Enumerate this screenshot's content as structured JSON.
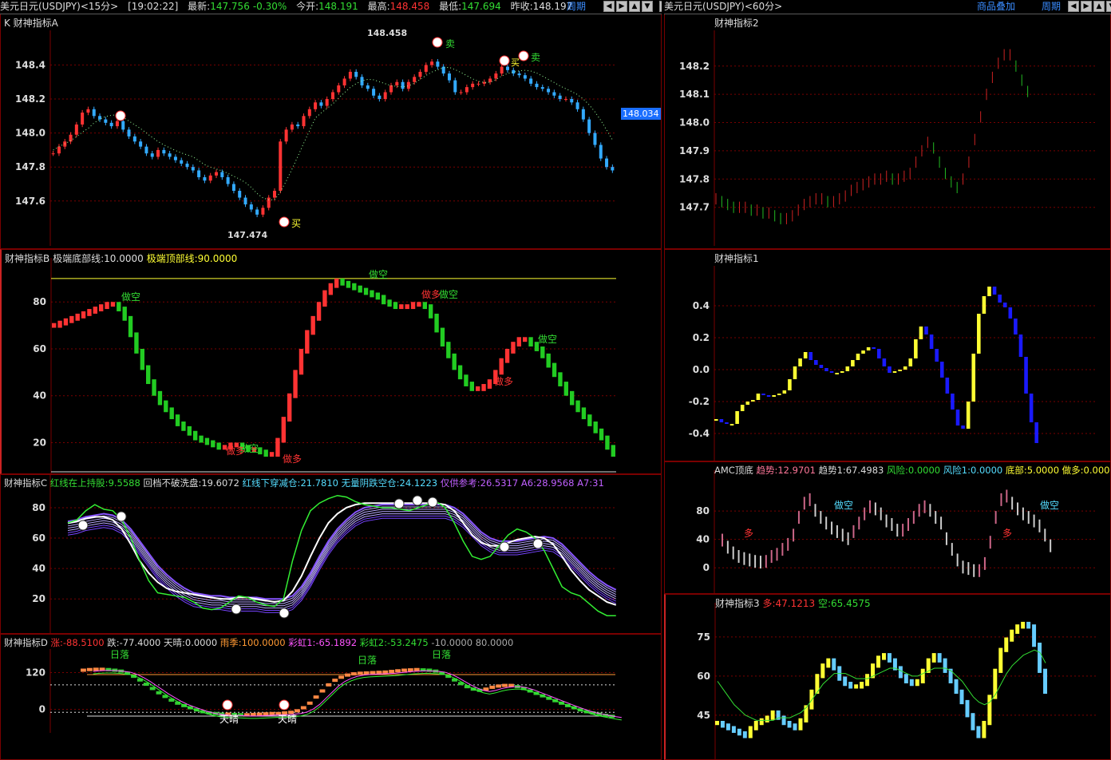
{
  "left_bar": {
    "symbol": "美元日元(USDJPY)<15分>",
    "time": "[19:02:22]",
    "latest_label": "最新:",
    "latest": "147.756",
    "change": "-0.30%",
    "open_label": "今开:",
    "open": "148.191",
    "high_label": "最高:",
    "high": "148.458",
    "low_label": "最低:",
    "low": "147.694",
    "prev_label": "昨收:",
    "prev": "148.197",
    "period_btn": "周期"
  },
  "right_bar": {
    "symbol": "美元日元(USDJPY)<60分>",
    "overlay_btn": "商品叠加",
    "period_btn": "周期"
  },
  "nav_glyphs": [
    "◀",
    "▶",
    "▲",
    "▼"
  ],
  "window_glyph": "□",
  "panes": {
    "A": {
      "title": "K  财神指标A",
      "hi_label": "148.458",
      "lo_label": "147.474",
      "price_tag": "148.034",
      "sell": "卖",
      "buy": "买"
    },
    "B": {
      "title": "财神指标B",
      "p1_label": "极端底部线:",
      "p1": "10.0000",
      "p2_label": "极端顶部线:",
      "p2": "90.0000",
      "short": "做空",
      "long": "做多"
    },
    "C": {
      "title": "财神指标C",
      "v1_label": "红线在上持股:",
      "v1": "9.5588",
      "v2_label": "回档不破洗盘:",
      "v2": "19.6072",
      "v3_label": "红线下穿减仓:",
      "v3": "21.7810",
      "v4_label": "无量阴跌空仓:",
      "v4": "24.1223",
      "v5_label": "仅供参考:",
      "v5": "26.5317",
      "v6_label": "A6:",
      "v6": "28.9568",
      "v7_label": "A7:31"
    },
    "D": {
      "title": "财神指标D",
      "v1_label": "涨:",
      "v1": "-88.5100",
      "v2_label": "跌:",
      "v2": "-77.4000",
      "v3_label": "天晴:",
      "v3": "0.0000",
      "v4_label": "雨季:",
      "v4": "100.0000",
      "v5_label": "彩虹1:",
      "v5": "-65.1892",
      "v6_label": "彩虹2:",
      "v6": "-53.2475",
      "v7": "-10.0000",
      "v8": "80.0000",
      "sunny": "天晴",
      "sun": "日落"
    },
    "R2": {
      "title": "财神指标2"
    },
    "R1": {
      "title": "财神指标1"
    },
    "AMC": {
      "title": "AMC顶底",
      "v1_label": "趋势:",
      "v1": "12.9701",
      "v2_label": "趋势1:",
      "v2": "67.4983",
      "v3_label": "风险:",
      "v3": "0.0000",
      "v4_label": "风险1:",
      "v4": "0.0000",
      "v5_label": "底部:",
      "v5": "5.0000",
      "v6_label": "做多:0.000",
      "short": "做空",
      "long": "多"
    },
    "R3": {
      "title": "财神指标3",
      "v1_label": "多:",
      "v1": "47.1213",
      "v2_label": "空:",
      "v2": "65.4575"
    }
  },
  "colors": {
    "up": "#ff3333",
    "down": "#33aaff",
    "grid": "#7a0000",
    "green": "#22cc22",
    "yellow": "#ffff33",
    "blue": "#1a1aff"
  },
  "chart_data": [
    {
      "id": "A",
      "type": "candlestick",
      "yticks": [
        147.6,
        147.8,
        148.0,
        148.2,
        148.4
      ],
      "ylim": [
        147.43,
        148.51
      ],
      "close": [
        147.88,
        147.92,
        147.95,
        147.99,
        148.05,
        148.12,
        148.14,
        148.1,
        148.08,
        148.06,
        148.04,
        148.07,
        148.02,
        147.98,
        147.95,
        147.92,
        147.88,
        147.86,
        147.9,
        147.88,
        147.86,
        147.84,
        147.82,
        147.8,
        147.78,
        147.74,
        147.72,
        147.75,
        147.77,
        147.74,
        147.7,
        147.66,
        147.62,
        147.58,
        147.55,
        147.52,
        147.56,
        147.62,
        147.66,
        147.95,
        148.02,
        148.05,
        148.04,
        148.1,
        148.14,
        148.18,
        148.16,
        148.2,
        148.24,
        148.28,
        148.32,
        148.36,
        148.33,
        148.28,
        148.26,
        148.22,
        148.2,
        148.24,
        148.28,
        148.3,
        148.26,
        148.3,
        148.33,
        148.36,
        148.4,
        148.42,
        148.39,
        148.35,
        148.31,
        148.24,
        148.24,
        148.27,
        148.29,
        148.29,
        148.3,
        148.32,
        148.35,
        148.39,
        148.37,
        148.35,
        148.34,
        148.32,
        148.29,
        148.27,
        148.26,
        148.24,
        148.22,
        148.2,
        148.2,
        148.18,
        148.14,
        148.08,
        148.0,
        147.93,
        147.85,
        147.8,
        147.78
      ]
    },
    {
      "id": "B",
      "type": "bar-indicator",
      "yticks": [
        20,
        40,
        60,
        80
      ],
      "ylim": [
        13,
        92
      ],
      "values": [
        70,
        71,
        72,
        73,
        74,
        75,
        76,
        77,
        78,
        79,
        79,
        77,
        73,
        66,
        59,
        52,
        46,
        41,
        37,
        34,
        31,
        28,
        26,
        24,
        22,
        21,
        20,
        19,
        18,
        18,
        19,
        19,
        18,
        17,
        17,
        16,
        15,
        15,
        21,
        30,
        40,
        50,
        59,
        67,
        73,
        79,
        84,
        87,
        89,
        88,
        87,
        86,
        85,
        84,
        83,
        82,
        80,
        79,
        78,
        78,
        78,
        79,
        79,
        78,
        74,
        68,
        62,
        57,
        52,
        48,
        45,
        43,
        43,
        44,
        46,
        50,
        55,
        59,
        62,
        64,
        64,
        62,
        60,
        57,
        53,
        49,
        45,
        41,
        37,
        34,
        31,
        28,
        25,
        22,
        18,
        15
      ],
      "ref_line": 90
    },
    {
      "id": "C",
      "type": "line-indicator",
      "yticks": [
        20,
        40,
        60,
        80
      ],
      "ylim": [
        7,
        91
      ],
      "green": [
        70,
        72,
        78,
        82,
        79,
        78,
        72,
        60,
        45,
        32,
        24,
        23,
        22,
        21,
        18,
        14,
        13,
        14,
        18,
        22,
        21,
        18,
        16,
        15,
        20,
        45,
        65,
        78,
        83,
        86,
        88,
        87,
        84,
        82,
        81,
        80,
        80,
        79,
        78,
        80,
        82,
        84,
        80,
        70,
        58,
        48,
        46,
        48,
        55,
        62,
        66,
        64,
        60,
        52,
        40,
        28,
        24,
        22,
        17,
        12,
        9,
        9
      ],
      "white": [
        70,
        71,
        73,
        74,
        74,
        72,
        66,
        56,
        45,
        37,
        31,
        27,
        25,
        24,
        23,
        22,
        21,
        20,
        20,
        21,
        21,
        20,
        19,
        18,
        19,
        25,
        35,
        48,
        60,
        70,
        76,
        80,
        82,
        83,
        83,
        83,
        83,
        83,
        83,
        83,
        83,
        83,
        82,
        78,
        70,
        62,
        57,
        55,
        55,
        57,
        59,
        60,
        61,
        60,
        56,
        48,
        39,
        32,
        26,
        22,
        18,
        16
      ],
      "purple": [
        71,
        72,
        74,
        75,
        76,
        75,
        72,
        66,
        58,
        50,
        42,
        36,
        31,
        27,
        24,
        23,
        22,
        22,
        21,
        21,
        21,
        21,
        20,
        20,
        20,
        22,
        28,
        37,
        48,
        58,
        66,
        72,
        77,
        80,
        81,
        82,
        82,
        82,
        82,
        82,
        82,
        82,
        82,
        80,
        76,
        70,
        64,
        60,
        58,
        58,
        58,
        59,
        60,
        61,
        60,
        56,
        50,
        44,
        38,
        33,
        29,
        26
      ]
    },
    {
      "id": "D",
      "type": "step-indicator",
      "yticks": [
        0,
        120
      ],
      "ylim": [
        -25,
        145
      ],
      "values": [
        128,
        130,
        131,
        131,
        130,
        128,
        125,
        118,
        108,
        96,
        82,
        68,
        54,
        42,
        30,
        20,
        12,
        5,
        -2,
        -8,
        -12,
        -14,
        -16,
        -16,
        -17,
        -18,
        -18,
        -17,
        -16,
        -15,
        -14,
        -14,
        -12,
        -10,
        -5,
        5,
        20,
        40,
        60,
        80,
        95,
        105,
        112,
        116,
        118,
        119,
        120,
        121,
        122,
        124,
        126,
        128,
        129,
        130,
        129,
        128,
        125,
        118,
        108,
        96,
        84,
        74,
        66,
        62,
        66,
        72,
        76,
        78,
        78,
        74,
        68,
        60,
        52,
        44,
        36,
        28,
        20,
        12,
        5,
        -2,
        -8,
        -12,
        -16,
        -20,
        -23
      ],
      "dotted_levels": [
        80,
        -10
      ]
    },
    {
      "id": "R2",
      "type": "stick",
      "yticks": [
        147.7,
        147.8,
        147.9,
        148.0,
        148.1,
        148.2
      ],
      "ylim": [
        147.62,
        148.27
      ],
      "values": [
        147.73,
        147.72,
        147.71,
        147.7,
        147.7,
        147.7,
        147.69,
        147.69,
        147.68,
        147.68,
        147.67,
        147.66,
        147.66,
        147.67,
        147.69,
        147.71,
        147.72,
        147.73,
        147.73,
        147.72,
        147.72,
        147.73,
        147.74,
        147.76,
        147.77,
        147.78,
        147.79,
        147.8,
        147.8,
        147.81,
        147.8,
        147.8,
        147.81,
        147.82,
        147.86,
        147.9,
        147.93,
        147.91,
        147.86,
        147.82,
        147.79,
        147.77,
        147.8,
        147.86,
        147.94,
        148.02,
        148.1,
        148.16,
        148.21,
        148.24,
        148.24,
        148.2,
        148.15,
        148.11
      ]
    },
    {
      "id": "R1",
      "type": "column",
      "yticks": [
        -0.4,
        -0.2,
        0,
        0.2,
        0.4
      ],
      "ylim": [
        -0.5,
        0.55
      ],
      "values": [
        -0.31,
        -0.33,
        -0.34,
        -0.34,
        -0.26,
        -0.22,
        -0.2,
        -0.19,
        -0.15,
        -0.16,
        -0.17,
        -0.16,
        -0.15,
        -0.13,
        -0.06,
        0.02,
        0.07,
        0.11,
        0.06,
        0.03,
        0.01,
        -0.01,
        -0.02,
        -0.02,
        -0.01,
        0.02,
        0.06,
        0.1,
        0.12,
        0.14,
        0.13,
        0.07,
        0.02,
        -0.02,
        -0.01,
        0.0,
        0.02,
        0.07,
        0.19,
        0.27,
        0.22,
        0.13,
        0.05,
        -0.05,
        -0.15,
        -0.25,
        -0.35,
        -0.37,
        -0.2,
        0.1,
        0.35,
        0.46,
        0.52,
        0.47,
        0.42,
        0.39,
        0.32,
        0.22,
        0.08,
        -0.15,
        -0.33,
        -0.46
      ]
    },
    {
      "id": "AMC",
      "type": "column",
      "yticks": [
        0,
        40,
        80
      ],
      "ylim": [
        -20,
        115
      ],
      "values": [
        48,
        38,
        30,
        25,
        22,
        20,
        18,
        17,
        18,
        25,
        28,
        35,
        42,
        55,
        80,
        100,
        105,
        90,
        80,
        72,
        65,
        60,
        55,
        50,
        60,
        72,
        85,
        95,
        92,
        85,
        75,
        70,
        62,
        62,
        70,
        80,
        90,
        95,
        90,
        80,
        72,
        50,
        35,
        20,
        10,
        8,
        5,
        5,
        15,
        45,
        80,
        105,
        110,
        100,
        92,
        85,
        80,
        75,
        68,
        55,
        40
      ]
    },
    {
      "id": "R3",
      "type": "column-with-line",
      "yticks": [
        45,
        60,
        75
      ],
      "ylim": [
        33,
        82
      ],
      "values": [
        42,
        41,
        40,
        39,
        38,
        37,
        40,
        42,
        43,
        44,
        46,
        44,
        42,
        41,
        40,
        43,
        48,
        54,
        60,
        64,
        66,
        63,
        59,
        57,
        56,
        56,
        57,
        60,
        64,
        67,
        68,
        66,
        63,
        60,
        58,
        57,
        58,
        62,
        66,
        68,
        66,
        62,
        58,
        54,
        50,
        45,
        40,
        37,
        42,
        52,
        62,
        70,
        74,
        77,
        79,
        80,
        79,
        72,
        62,
        54
      ],
      "line": [
        58,
        55,
        52,
        49,
        47,
        45,
        44,
        43,
        43,
        43,
        43,
        44,
        44,
        44,
        45,
        46,
        48,
        51,
        54,
        57,
        59,
        61,
        61,
        61,
        60,
        59,
        59,
        59,
        60,
        61,
        62,
        63,
        63,
        62,
        61,
        60,
        60,
        61,
        62,
        63,
        63,
        63,
        62,
        60,
        58,
        55,
        52,
        50,
        49,
        50,
        53,
        57,
        61,
        64,
        66,
        68,
        69,
        70,
        69,
        65
      ]
    }
  ]
}
